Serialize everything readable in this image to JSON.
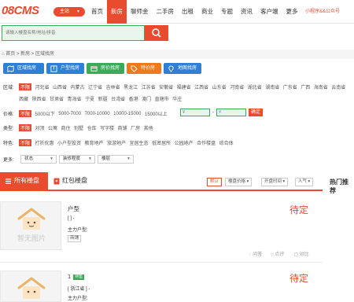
{
  "header": {
    "logo": "08CMS",
    "site_select": "主站",
    "nav": [
      "首页",
      "新房",
      "聊师金",
      "二手房",
      "出租",
      "商业",
      "专题",
      "资讯",
      "客户端",
      "更多"
    ],
    "nav_active": 1,
    "miniapp": "小程序&&公众号"
  },
  "search": {
    "placeholder": "请输入楼盘名称/地址/拼音"
  },
  "breadcrumb": "首页 > 新房 > 区域找房",
  "tabs": [
    {
      "label": "区域找房",
      "color": "#2d7fd8",
      "icon": "map-icon"
    },
    {
      "label": "户型找房",
      "color": "#2d7fd8",
      "icon": "floorplan-icon"
    },
    {
      "label": "房价找房",
      "color": "#3aab5a",
      "icon": "price-icon"
    },
    {
      "label": "特价房",
      "color": "#f07a1a",
      "icon": "tag-icon"
    },
    {
      "label": "地图找房",
      "color": "#2d7fd8",
      "icon": "map-pin-icon"
    }
  ],
  "filters": {
    "region": {
      "label": "区域:",
      "all": "不限",
      "items": [
        "河北省",
        "山西省",
        "内蒙古",
        "辽宁省",
        "吉林省",
        "黑龙江",
        "江苏省",
        "安徽省",
        "福建省",
        "江西省",
        "山东省",
        "河南省",
        "湖北省",
        "湖南省",
        "广东省",
        "广西",
        "海南省",
        "云南省",
        "西藏",
        "陕西省",
        "甘肃省",
        "青海省",
        "宁夏",
        "新疆",
        "台湾省",
        "香港",
        "澳门",
        "直辖市",
        "华庄"
      ]
    },
    "price": {
      "label": "价格:",
      "all": "不限",
      "items": [
        "5000以下",
        "5000-7000",
        "7000-10000",
        "10000-15000",
        "15000以上"
      ],
      "unit": "¥",
      "dash": "-",
      "confirm": "确定"
    },
    "type": {
      "label": "类型:",
      "all": "不限",
      "items": [
        "对顶",
        "公寓",
        "商住",
        "别墅",
        "仓库",
        "写字楼",
        "商铺",
        "厂房",
        "其他"
      ]
    },
    "feature": {
      "label": "特色:",
      "all": "不限",
      "items": [
        "打折优惠",
        "小户型投资",
        "教育地产",
        "旅游地产",
        "宜居生态",
        "低密居所",
        "公园地产",
        "合作楼盘",
        "综合体"
      ]
    },
    "more": {
      "label": "更多:",
      "selects": [
        "状态",
        "装修程度",
        "楼层"
      ]
    }
  },
  "list_tabs": {
    "all": "所有楼盘",
    "hongbao": "红包楼盘"
  },
  "sorts": [
    "默认",
    "楼盘价格",
    "开盘时间",
    "人气"
  ],
  "hot": "热门推荐",
  "listings": [
    {
      "noimg": "暂无图片",
      "title": "户型",
      "price": "待定",
      "addr": "[ ] -",
      "main": "主力户型:",
      "tag": "商铺",
      "actions": [
        "问答",
        "点评",
        "对比"
      ]
    },
    {
      "noimg": "暂无图片",
      "title": "1",
      "badge": "待售",
      "price": "待定",
      "addr": "[ 浙江省 ] -",
      "main": "主力户型:"
    }
  ]
}
